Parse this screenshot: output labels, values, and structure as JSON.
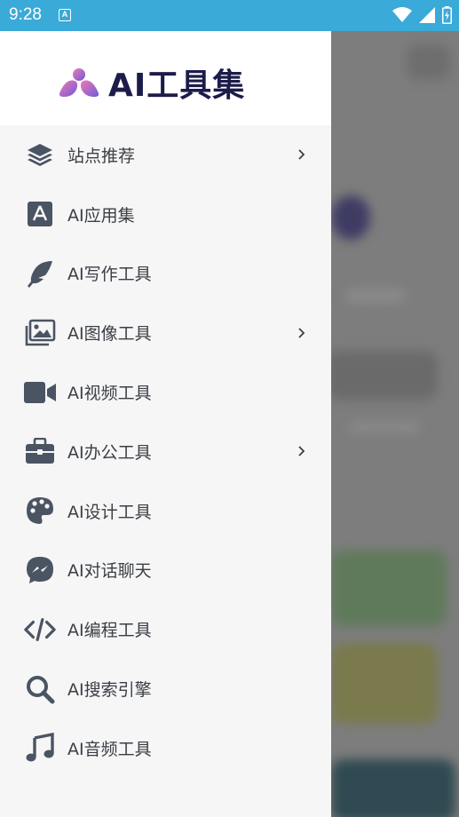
{
  "status_bar": {
    "time": "9:28",
    "notification_icon": "A",
    "icons": [
      "wifi-icon",
      "signal-icon",
      "battery-icon"
    ]
  },
  "drawer": {
    "logo_title": "AI工具集",
    "items": [
      {
        "label": "站点推荐",
        "icon": "layers-icon",
        "has_chevron": true
      },
      {
        "label": "AI应用集",
        "icon": "app-store-icon",
        "has_chevron": false
      },
      {
        "label": "AI写作工具",
        "icon": "feather-icon",
        "has_chevron": false
      },
      {
        "label": "AI图像工具",
        "icon": "images-icon",
        "has_chevron": true
      },
      {
        "label": "AI视频工具",
        "icon": "video-icon",
        "has_chevron": false
      },
      {
        "label": "AI办公工具",
        "icon": "briefcase-icon",
        "has_chevron": true
      },
      {
        "label": "AI设计工具",
        "icon": "palette-icon",
        "has_chevron": false
      },
      {
        "label": "AI对话聊天",
        "icon": "messenger-icon",
        "has_chevron": false
      },
      {
        "label": "AI编程工具",
        "icon": "code-icon",
        "has_chevron": false
      },
      {
        "label": "AI搜索引擎",
        "icon": "search-icon",
        "has_chevron": false
      },
      {
        "label": "AI音频工具",
        "icon": "music-icon",
        "has_chevron": false
      }
    ]
  },
  "colors": {
    "status_bar": "#3aaad8",
    "icon": "#4b5463",
    "text": "#3b3f46",
    "logo_text": "#1c1c4a",
    "logo_gradient_start": "#f178b6",
    "logo_gradient_end": "#6f5bd6"
  }
}
